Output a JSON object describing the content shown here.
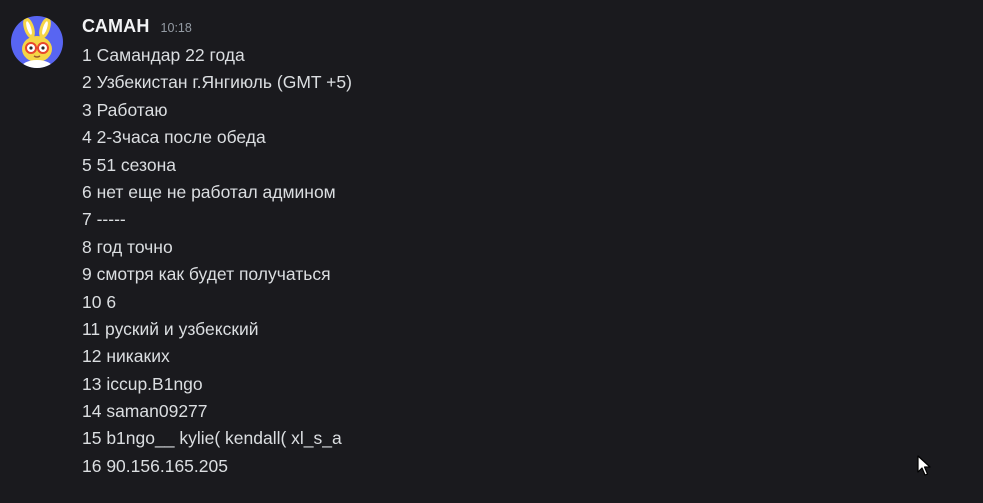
{
  "message": {
    "author": "САМАН",
    "timestamp": "10:18",
    "lines": [
      "1 Самандар 22 года",
      "2 Узбекистан г.Янгиюль (GMT +5)",
      "3 Работаю",
      "4 2-3часа после обеда",
      "5 51 сезона",
      "6 нет еще не работал админом",
      "7 -----",
      "8 год точно",
      "9 смотря как будет получаться",
      "10 6",
      "11 руский и узбекский",
      "12 никаких",
      "13 iccup.B1ngo",
      "14 saman09277",
      "15 b1ngo__ kylie( kendall( xl_s_a",
      "16 90.156.165.205"
    ]
  },
  "avatar": {
    "icon": "bunny-avatar-icon",
    "background_color": "#5865f2",
    "character_color": "#f5d547"
  },
  "colors": {
    "background": "#1a1a1e",
    "username": "#f2f3f5",
    "text": "#dbdee1",
    "timestamp": "#949ba4"
  },
  "cursor": {
    "icon": "mouse-pointer-icon"
  }
}
